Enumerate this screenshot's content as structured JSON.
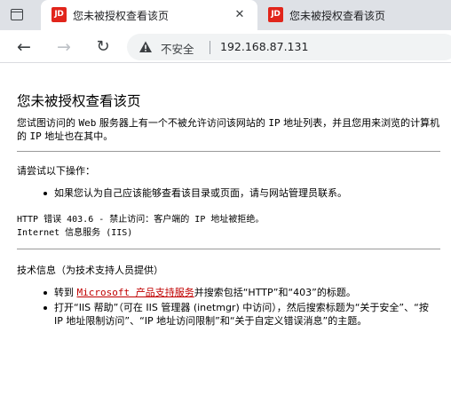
{
  "browser": {
    "tabs": [
      {
        "favicon_text": "JD",
        "title": "您未被授权查看该页",
        "close": "✕",
        "active": true
      },
      {
        "favicon_text": "JD",
        "title": "您未被授权查看该页",
        "active": false
      }
    ],
    "toolbar": {
      "back_glyph": "←",
      "forward_glyph": "→",
      "reload_glyph": "↻",
      "security_label": "不安全",
      "url": "192.168.87.131"
    }
  },
  "page": {
    "title": "您未被授权查看该页",
    "description": {
      "part1": "您试图访问的 ",
      "web": "Web",
      "part2": " 服务器上有一个不被允许访问该网站的 ",
      "ip1": "IP",
      "part3": " 地址列表，并且您用来浏览的计算机的 ",
      "ip2": "IP",
      "part4": " 地址也在其中。"
    },
    "try_heading": "请尝试以下操作：",
    "try_items": [
      "如果您认为自己应该能够查看该目录或页面，请与网站管理员联系。"
    ],
    "error_line": "HTTP 错误 403.6 - 禁止访问：客户端的 IP 地址被拒绝。",
    "server_line": "Internet 信息服务 (IIS)",
    "tech_heading": "技术信息（为技术支持人员提供）",
    "tech_items": {
      "item1_prefix": "转到 ",
      "item1_link": "Microsoft 产品支持服务",
      "item1_suffix": "并搜索包括“HTTP”和“403”的标题。",
      "item2": "打开“IIS 帮助”（可在 IIS 管理器 (inetmgr) 中访问），然后搜索标题为“关于安全”、“按 IP 地址限制访问”、“IP 地址访问限制”和“关于自定义错误消息”的主题。"
    }
  },
  "colors": {
    "favicon_bg": "#e1251b",
    "link_red": "#c00000",
    "tabstrip_bg": "#dee1e6",
    "omnibox_bg": "#f1f3f4"
  }
}
